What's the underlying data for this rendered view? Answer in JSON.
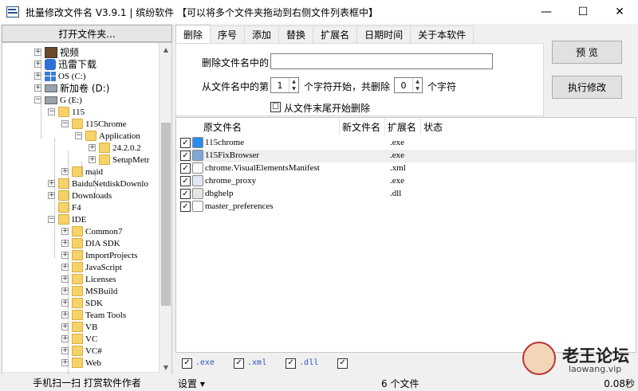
{
  "window": {
    "title": "批量修改文件名 V3.9.1 | 缤纷软件  【可以将多个文件夹拖动到右侧文件列表框中】",
    "minimize": "—",
    "maximize": "☐",
    "close": "✕"
  },
  "left": {
    "open_folder": "打开文件夹...",
    "scan_label": "手机扫一扫 打赏软件作者",
    "tree": [
      {
        "label": "视频",
        "icon": "video-icon",
        "expand": "+"
      },
      {
        "label": "迅雷下载",
        "icon": "thunder-icon",
        "expand": "+"
      },
      {
        "label": "OS (C:)",
        "icon": "windows-drive-icon",
        "expand": "+"
      },
      {
        "label": "新加卷 (D:)",
        "icon": "drive-icon",
        "expand": "+"
      },
      {
        "label": "G (E:)",
        "icon": "drive-icon",
        "expand": "−"
      },
      {
        "label": "115",
        "icon": "folder-icon",
        "expand": "−"
      },
      {
        "label": "115Chrome",
        "icon": "folder-icon",
        "expand": "−"
      },
      {
        "label": "Application",
        "icon": "folder-icon",
        "expand": "−"
      },
      {
        "label": "24.2.0.2",
        "icon": "folder-icon",
        "expand": "+"
      },
      {
        "label": "SetupMetr",
        "icon": "folder-icon",
        "expand": "+"
      },
      {
        "label": "maid",
        "icon": "folder-icon",
        "expand": "+"
      },
      {
        "label": "BaiduNetdiskDownlo",
        "icon": "folder-icon",
        "expand": "+"
      },
      {
        "label": "Downloads",
        "icon": "folder-icon",
        "expand": "+"
      },
      {
        "label": "F4",
        "icon": "folder-icon",
        "expand": ""
      },
      {
        "label": "IDE",
        "icon": "folder-icon",
        "expand": "−"
      },
      {
        "label": "Common7",
        "icon": "folder-icon",
        "expand": "+"
      },
      {
        "label": "DIA SDK",
        "icon": "folder-icon",
        "expand": "+"
      },
      {
        "label": "ImportProjects",
        "icon": "folder-icon",
        "expand": "+"
      },
      {
        "label": "JavaScript",
        "icon": "folder-icon",
        "expand": "+"
      },
      {
        "label": "Licenses",
        "icon": "folder-icon",
        "expand": "+"
      },
      {
        "label": "MSBuild",
        "icon": "folder-icon",
        "expand": "+"
      },
      {
        "label": "SDK",
        "icon": "folder-icon",
        "expand": "+"
      },
      {
        "label": "Team Tools",
        "icon": "folder-icon",
        "expand": "+"
      },
      {
        "label": "VB",
        "icon": "folder-icon",
        "expand": "+"
      },
      {
        "label": "VC",
        "icon": "folder-icon",
        "expand": "+"
      },
      {
        "label": "VC#",
        "icon": "folder-icon",
        "expand": "+"
      },
      {
        "label": "Web",
        "icon": "folder-icon",
        "expand": "+"
      }
    ]
  },
  "tabs": [
    "删除",
    "序号",
    "添加",
    "替换",
    "扩展名",
    "日期时间",
    "关于本软件"
  ],
  "delete_tab": {
    "remove_label": "删除文件名中的",
    "remove_value": "",
    "from_label_a": "从文件名中的第",
    "start_value": "1",
    "from_label_b": "个字符开始，共删除",
    "count_value": "0",
    "from_label_c": "个字符",
    "from_end_label": "从文件末尾开始删除",
    "from_end_checked": "☐"
  },
  "buttons": {
    "preview": "预    览",
    "execute": "执行修改"
  },
  "file_list": {
    "columns": [
      "原文件名",
      "新文件名",
      "扩展名",
      "状态"
    ],
    "rows": [
      {
        "check": "✓",
        "icon": "115chrome-icon",
        "name": "115chrome",
        "new": "",
        "ext": ".exe"
      },
      {
        "check": "✓",
        "icon": "wrench-icon",
        "name": "115FixBrowser",
        "new": "",
        "ext": ".exe"
      },
      {
        "check": "✓",
        "icon": "document-icon",
        "name": "chrome.VisualElementsManifest",
        "new": "",
        "ext": ".xml"
      },
      {
        "check": "✓",
        "icon": "application-icon",
        "name": "chrome_proxy",
        "new": "",
        "ext": ".exe"
      },
      {
        "check": "✓",
        "icon": "dll-icon",
        "name": "dbghelp",
        "new": "",
        "ext": ".dll"
      },
      {
        "check": "✓",
        "icon": "blank-file-icon",
        "name": "master_preferences",
        "new": "",
        "ext": ""
      }
    ]
  },
  "filters": [
    {
      "check": "✓",
      "label": ".exe"
    },
    {
      "check": "✓",
      "label": ".xml"
    },
    {
      "check": "✓",
      "label": ".dll"
    },
    {
      "check": "✓",
      "label": ""
    }
  ],
  "status": {
    "settings": "设置 ▾",
    "count": "6 个文件",
    "timer": "0.08秒"
  },
  "watermark": {
    "title": "老王论坛",
    "url": "laowang.vip"
  },
  "colors": {
    "accent": "#2a4fbf",
    "folder": "#f6d36a",
    "selection": "#efefef"
  }
}
